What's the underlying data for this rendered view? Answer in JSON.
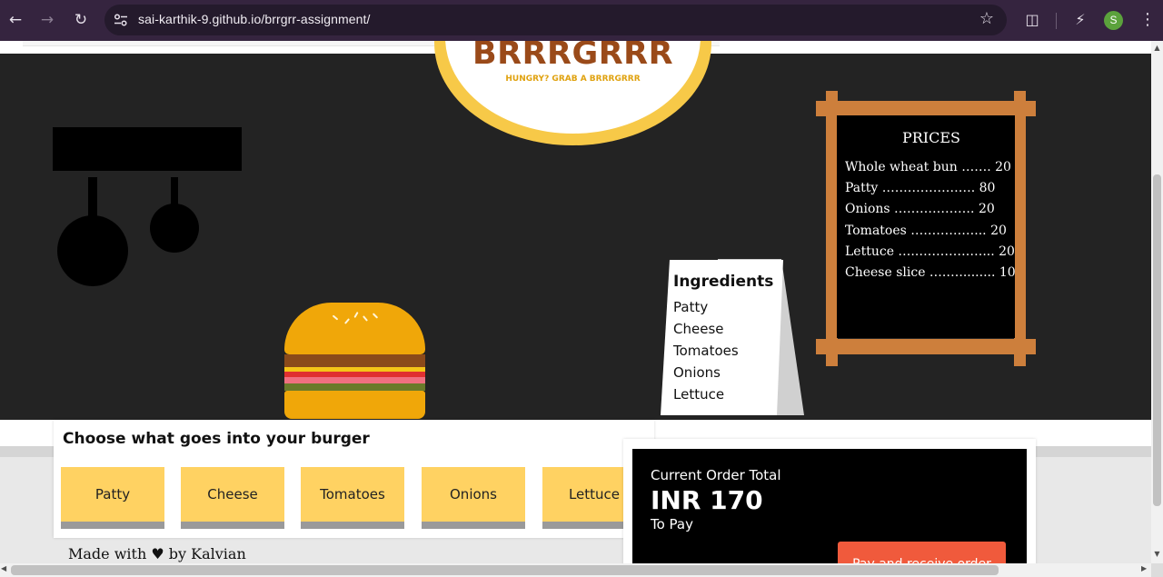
{
  "browser": {
    "url": "sai-karthik-9.github.io/brrgrr-assignment/",
    "icons": {
      "back": "back-arrow-icon",
      "forward": "forward-arrow-icon",
      "reload": "reload-icon",
      "site_info": "tune-icon",
      "bookmark": "star-icon",
      "extensions": "puzzle-icon",
      "performance": "performance-icon",
      "menu": "kebab-menu-icon"
    },
    "profile_initial": "S",
    "profile_color": "#5ba23c",
    "chrome_color": "#35243f"
  },
  "logo": {
    "title": "BRRRGRRR",
    "tagline": "HUNGRY? GRAB A BRRRGRRR",
    "title_color": "#9a4a19",
    "ring_color": "#f7c948"
  },
  "ingredients_card": {
    "title": "Ingredients",
    "items": [
      "Patty",
      "Cheese",
      "Tomatoes",
      "Onions",
      "Lettuce"
    ]
  },
  "price_board": {
    "title": "PRICES",
    "rows": [
      "Whole wheat bun ……. 20",
      "Patty …………………. 80",
      "Onions ………………. 20",
      "Tomatoes ……………... 20",
      "Lettuce …..……………... 20",
      "Cheese slice ….…......... 10"
    ],
    "frame_color": "#cd7f3c"
  },
  "choose": {
    "title": "Choose what goes into your burger",
    "buttons": [
      "Patty",
      "Cheese",
      "Tomatoes",
      "Onions",
      "Lettuce"
    ],
    "button_color": "#ffd262"
  },
  "order": {
    "label": "Current Order Total",
    "amount": "INR 170",
    "sub": "To Pay",
    "pay_button": "Pay and receive order",
    "pay_color": "#f05a3c"
  },
  "footer": {
    "text": "Made with ♥ by Kalvian"
  }
}
